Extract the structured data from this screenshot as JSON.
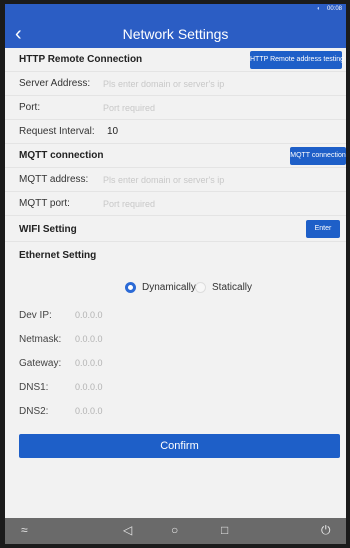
{
  "status_bar": {
    "time": "00:08",
    "signal_icon": "signal-icon"
  },
  "header": {
    "title": "Network Settings",
    "back_icon": "back-chevron-icon"
  },
  "http": {
    "section_title": "HTTP Remote Connection",
    "test_button": "HTTP Remote address testing",
    "server_address_label": "Server Address:",
    "server_address_placeholder": "Pls enter domain or server's ip",
    "port_label": "Port:",
    "port_placeholder": "Port required",
    "interval_label": "Request Interval:",
    "interval_value": "10"
  },
  "mqtt": {
    "section_title": "MQTT connection",
    "button": "MQTT connection",
    "address_label": "MQTT address:",
    "address_placeholder": "Pls enter domain or server's ip",
    "port_label": "MQTT port:",
    "port_placeholder": "Port required"
  },
  "wifi": {
    "section_title": "WIFI Setting",
    "enter_button": "Enter"
  },
  "ethernet": {
    "section_title": "Ethernet Setting",
    "mode_dynamic": "Dynamically",
    "mode_static": "Statically",
    "selected_mode": "Dynamically",
    "dev_ip_label": "Dev IP:",
    "dev_ip_value": "0.0.0.0",
    "netmask_label": "Netmask:",
    "netmask_value": "0.0.0.0",
    "gateway_label": "Gateway:",
    "gateway_value": "0.0.0.0",
    "dns1_label": "DNS1:",
    "dns1_value": "0.0.0.0",
    "dns2_label": "DNS2:",
    "dns2_value": "0.0.0.0"
  },
  "confirm_button": "Confirm",
  "nav_bar": {
    "icons": [
      "collapse-icon",
      "back-triangle-icon",
      "home-circle-icon",
      "recents-square-icon",
      "power-icon"
    ]
  },
  "colors": {
    "primary": "#2b5dc4",
    "button": "#1e5fc8",
    "background": "#f2f2f2",
    "placeholder": "#c8c8c8"
  }
}
